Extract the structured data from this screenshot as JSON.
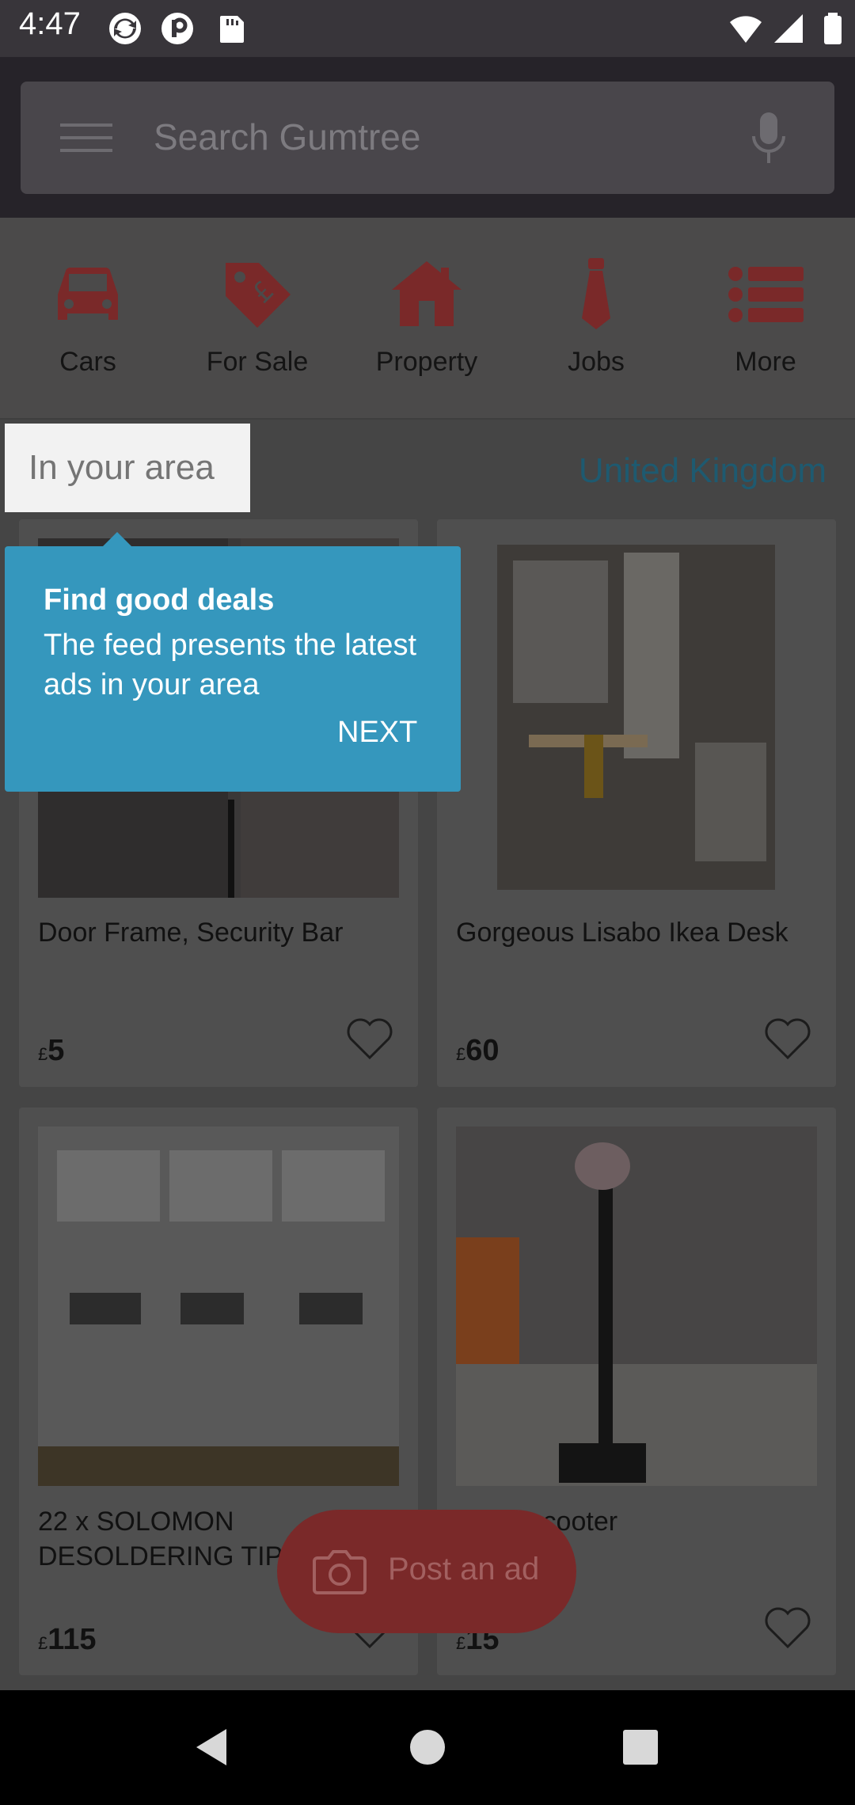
{
  "status_bar": {
    "time": "4:47",
    "left_icons": [
      "sync-icon",
      "p-app-icon",
      "sd-card-icon"
    ],
    "right_icons": [
      "wifi-icon",
      "signal-icon",
      "battery-icon"
    ]
  },
  "search": {
    "placeholder": "Search Gumtree",
    "menu_icon": "hamburger-menu-icon",
    "voice_icon": "microphone-icon"
  },
  "categories": [
    {
      "label": "Cars",
      "icon": "car-icon"
    },
    {
      "label": "For Sale",
      "icon": "price-tag-icon"
    },
    {
      "label": "Property",
      "icon": "house-icon"
    },
    {
      "label": "Jobs",
      "icon": "tie-icon"
    },
    {
      "label": "More",
      "icon": "list-icon"
    }
  ],
  "feed": {
    "area_label": "In your area",
    "location": "United Kingdom"
  },
  "listings": [
    {
      "title": "Door Frame, Security Bar",
      "currency": "£",
      "price": "5"
    },
    {
      "title": "Gorgeous Lisabo Ikea Desk",
      "currency": "£",
      "price": "60"
    },
    {
      "title": "22 x SOLOMON DESOLDERING TIPS",
      "currency": "£",
      "price": "115"
    },
    {
      "title": "Micro scooter",
      "currency": "£",
      "price": "15"
    }
  ],
  "tooltip": {
    "title": "Find good deals",
    "body": "The feed presents the latest ads in your area",
    "next_label": "NEXT"
  },
  "fab": {
    "label": "Post an ad",
    "icon": "camera-icon"
  },
  "colors": {
    "brand_red": "#7a2929",
    "tooltip_blue": "#3597bd",
    "link_blue": "#1e5a70"
  },
  "nav_bar": {
    "buttons": [
      "back-icon",
      "home-icon",
      "recents-icon"
    ]
  }
}
